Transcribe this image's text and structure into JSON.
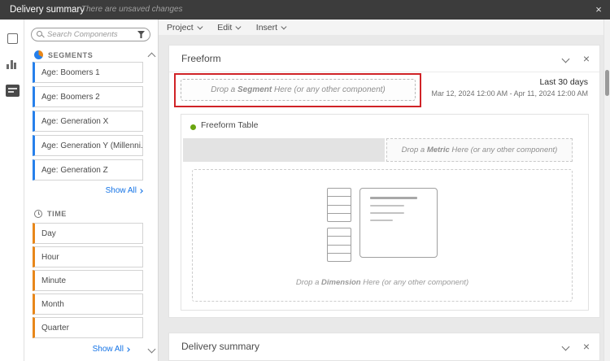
{
  "topbar": {
    "title": "Delivery summary",
    "unsaved_notice": "There are unsaved changes"
  },
  "menubar": {
    "items": [
      {
        "label": "Project"
      },
      {
        "label": "Edit"
      },
      {
        "label": "Insert"
      }
    ]
  },
  "components_panel": {
    "search_placeholder": "Search Components",
    "segments": {
      "label": "SEGMENTS",
      "items": [
        "Age: Boomers 1",
        "Age: Boomers 2",
        "Age: Generation X",
        "Age: Generation Y (Millenni...",
        "Age: Generation Z"
      ],
      "show_all": "Show All"
    },
    "time": {
      "label": "TIME",
      "items": [
        "Day",
        "Hour",
        "Minute",
        "Month",
        "Quarter"
      ],
      "show_all": "Show All"
    }
  },
  "freeform_panel": {
    "title": "Freeform",
    "segment_drop": {
      "pre": "Drop a ",
      "keyword": "Segment",
      "post": " Here (or any other component)"
    },
    "date_range": {
      "label": "Last 30 days",
      "range": "Mar 12, 2024 12:00 AM - Apr 11, 2024 12:00 AM"
    },
    "table": {
      "title": "Freeform Table",
      "metric_drop": {
        "pre": "Drop a ",
        "keyword": "Metric",
        "post": " Here (or any other component)"
      },
      "dimension_drop": {
        "pre": "Drop a ",
        "keyword": "Dimension",
        "post": " Here (or any other component)"
      }
    }
  },
  "delivery_panel": {
    "title": "Delivery summary"
  },
  "icons": {
    "close": "×"
  },
  "colors": {
    "segment_accent": "#2680eb",
    "time_accent": "#e8871a",
    "link_blue": "#1473e6",
    "annotation_red": "#d02327",
    "freeform_table_dot": "#6aa510"
  }
}
